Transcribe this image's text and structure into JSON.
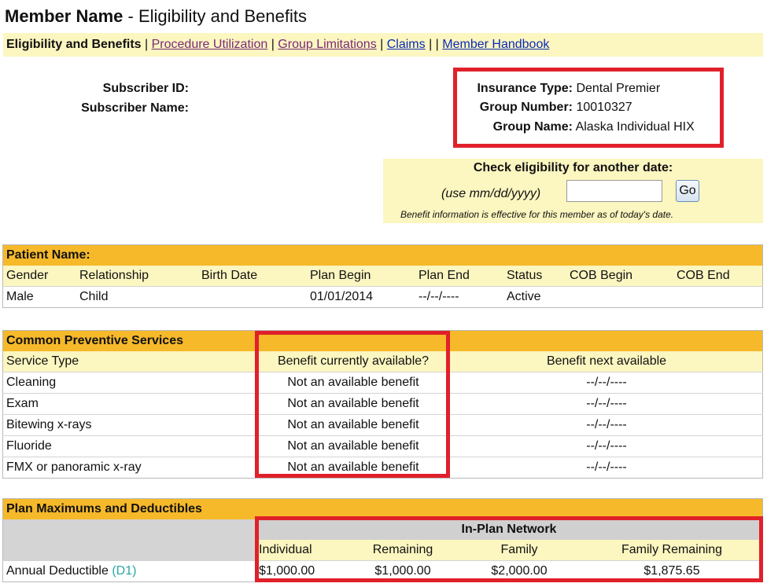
{
  "title": {
    "bold": "Member Name",
    "rest": " - Eligibility and Benefits"
  },
  "nav": {
    "current": "Eligibility and Benefits",
    "links": [
      "Procedure Utilization",
      "Group Limitations",
      "Claims",
      "Member Handbook"
    ],
    "sep": " | ",
    "sep_double": " | | "
  },
  "subscriber": {
    "id_label": "Subscriber ID:",
    "name_label": "Subscriber Name:"
  },
  "insurance": {
    "type_label": "Insurance Type:",
    "type_value": "Dental Premier",
    "group_number_label": "Group Number:",
    "group_number_value": "10010327",
    "group_name_label": "Group Name:",
    "group_name_value": "Alaska Individual HIX"
  },
  "eligibility": {
    "heading": "Check eligibility for another date:",
    "hint": "(use mm/dd/yyyy)",
    "date_value": "",
    "go_label": "Go",
    "note": "Benefit information is effective for this member as of today's date."
  },
  "patient": {
    "header": "Patient Name:",
    "columns": [
      "Gender",
      "Relationship",
      "Birth Date",
      "Plan Begin",
      "Plan End",
      "Status",
      "COB Begin",
      "COB End"
    ],
    "row": [
      "Male",
      "Child",
      "",
      "01/01/2014",
      "--/--/----",
      "Active",
      "",
      ""
    ]
  },
  "preventive": {
    "header": "Common Preventive Services",
    "columns": [
      "Service Type",
      "Benefit currently available?",
      "Benefit next available"
    ],
    "rows": [
      [
        "Cleaning",
        "Not an available benefit",
        "--/--/----"
      ],
      [
        "Exam",
        "Not an available benefit",
        "--/--/----"
      ],
      [
        "Bitewing x-rays",
        "Not an available benefit",
        "--/--/----"
      ],
      [
        "Fluoride",
        "Not an available benefit",
        "--/--/----"
      ],
      [
        "FMX or panoramic x-ray",
        "Not an available benefit",
        "--/--/----"
      ]
    ]
  },
  "maximums": {
    "header": "Plan Maximums and Deductibles",
    "network": "In-Plan Network",
    "columns": [
      "Individual",
      "Remaining",
      "Family",
      "Family Remaining"
    ],
    "row_label": "Annual Deductible",
    "row_code": "(D1)",
    "row": [
      "$1,000.00",
      "$1,000.00",
      "$2,000.00",
      "$1,875.65"
    ]
  },
  "colors": {
    "highlight": "#e0202a",
    "header_bg": "#f6b92a",
    "sub_bg": "#fcf6c0"
  }
}
